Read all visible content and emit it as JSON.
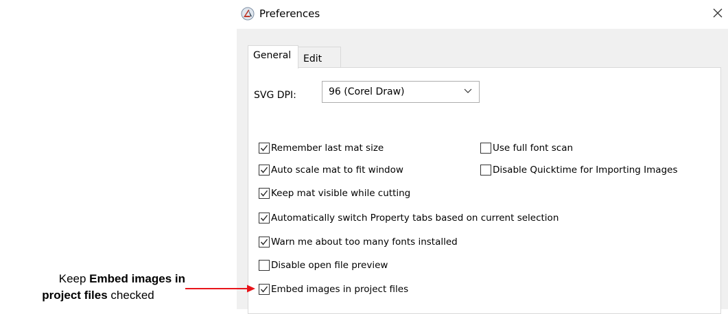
{
  "window": {
    "title": "Preferences",
    "close_glyph": "✕",
    "icon": "app-logo-icon"
  },
  "tabs": [
    {
      "label": "General",
      "active": true
    },
    {
      "label": "Edit",
      "active": false
    }
  ],
  "svg_dpi": {
    "label": "SVG DPI:",
    "selected": "96 (Corel Draw)"
  },
  "options": {
    "remember_mat": {
      "label": "Remember last mat size",
      "checked": true
    },
    "full_font_scan": {
      "label": "Use full font scan",
      "checked": false
    },
    "auto_scale": {
      "label": "Auto scale mat to fit window",
      "checked": true
    },
    "disable_quicktime": {
      "label": "Disable Quicktime for Importing Images",
      "checked": false
    },
    "keep_mat_visible": {
      "label": "Keep mat visible while cutting",
      "checked": true
    },
    "auto_switch_tabs": {
      "label": "Automatically switch Property tabs based on current selection",
      "checked": true
    },
    "warn_fonts": {
      "label": "Warn me about too many fonts installed",
      "checked": true
    },
    "disable_preview": {
      "label": "Disable open file preview",
      "checked": false
    },
    "embed_images": {
      "label": "Embed images in project files",
      "checked": true
    }
  },
  "annotation": {
    "prefix": "Keep ",
    "bold1": "Embed images in",
    "bold2": "project files",
    "suffix": " checked",
    "arrow_color": "#e8141a"
  }
}
